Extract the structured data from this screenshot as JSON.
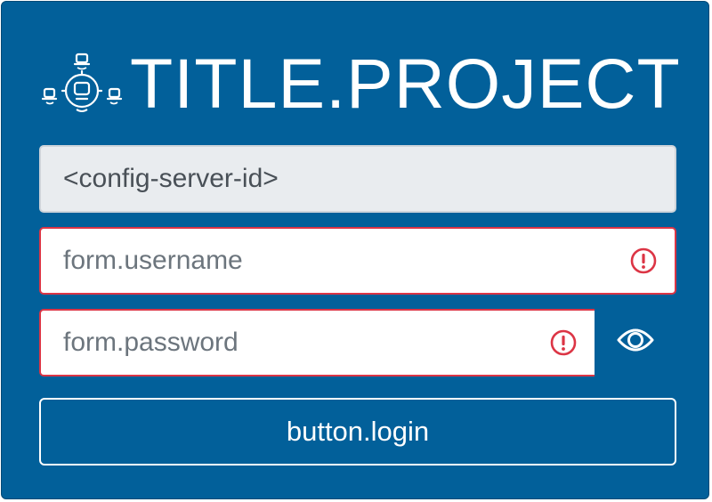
{
  "header": {
    "logo_icon": "network-monitor-logo-icon",
    "title": "TITLE.PROJECT"
  },
  "form": {
    "server_id": {
      "value": "<config-server-id>"
    },
    "username": {
      "placeholder": "form.username",
      "value": "",
      "status": "invalid"
    },
    "password": {
      "placeholder": "form.password",
      "value": "",
      "status": "invalid"
    },
    "show_password_icon": "eye-icon",
    "login_label": "button.login"
  },
  "colors": {
    "background": "#02609a",
    "error": "#dc3545",
    "readonly_field": "#e9ecef",
    "text_light": "#ffffff"
  }
}
